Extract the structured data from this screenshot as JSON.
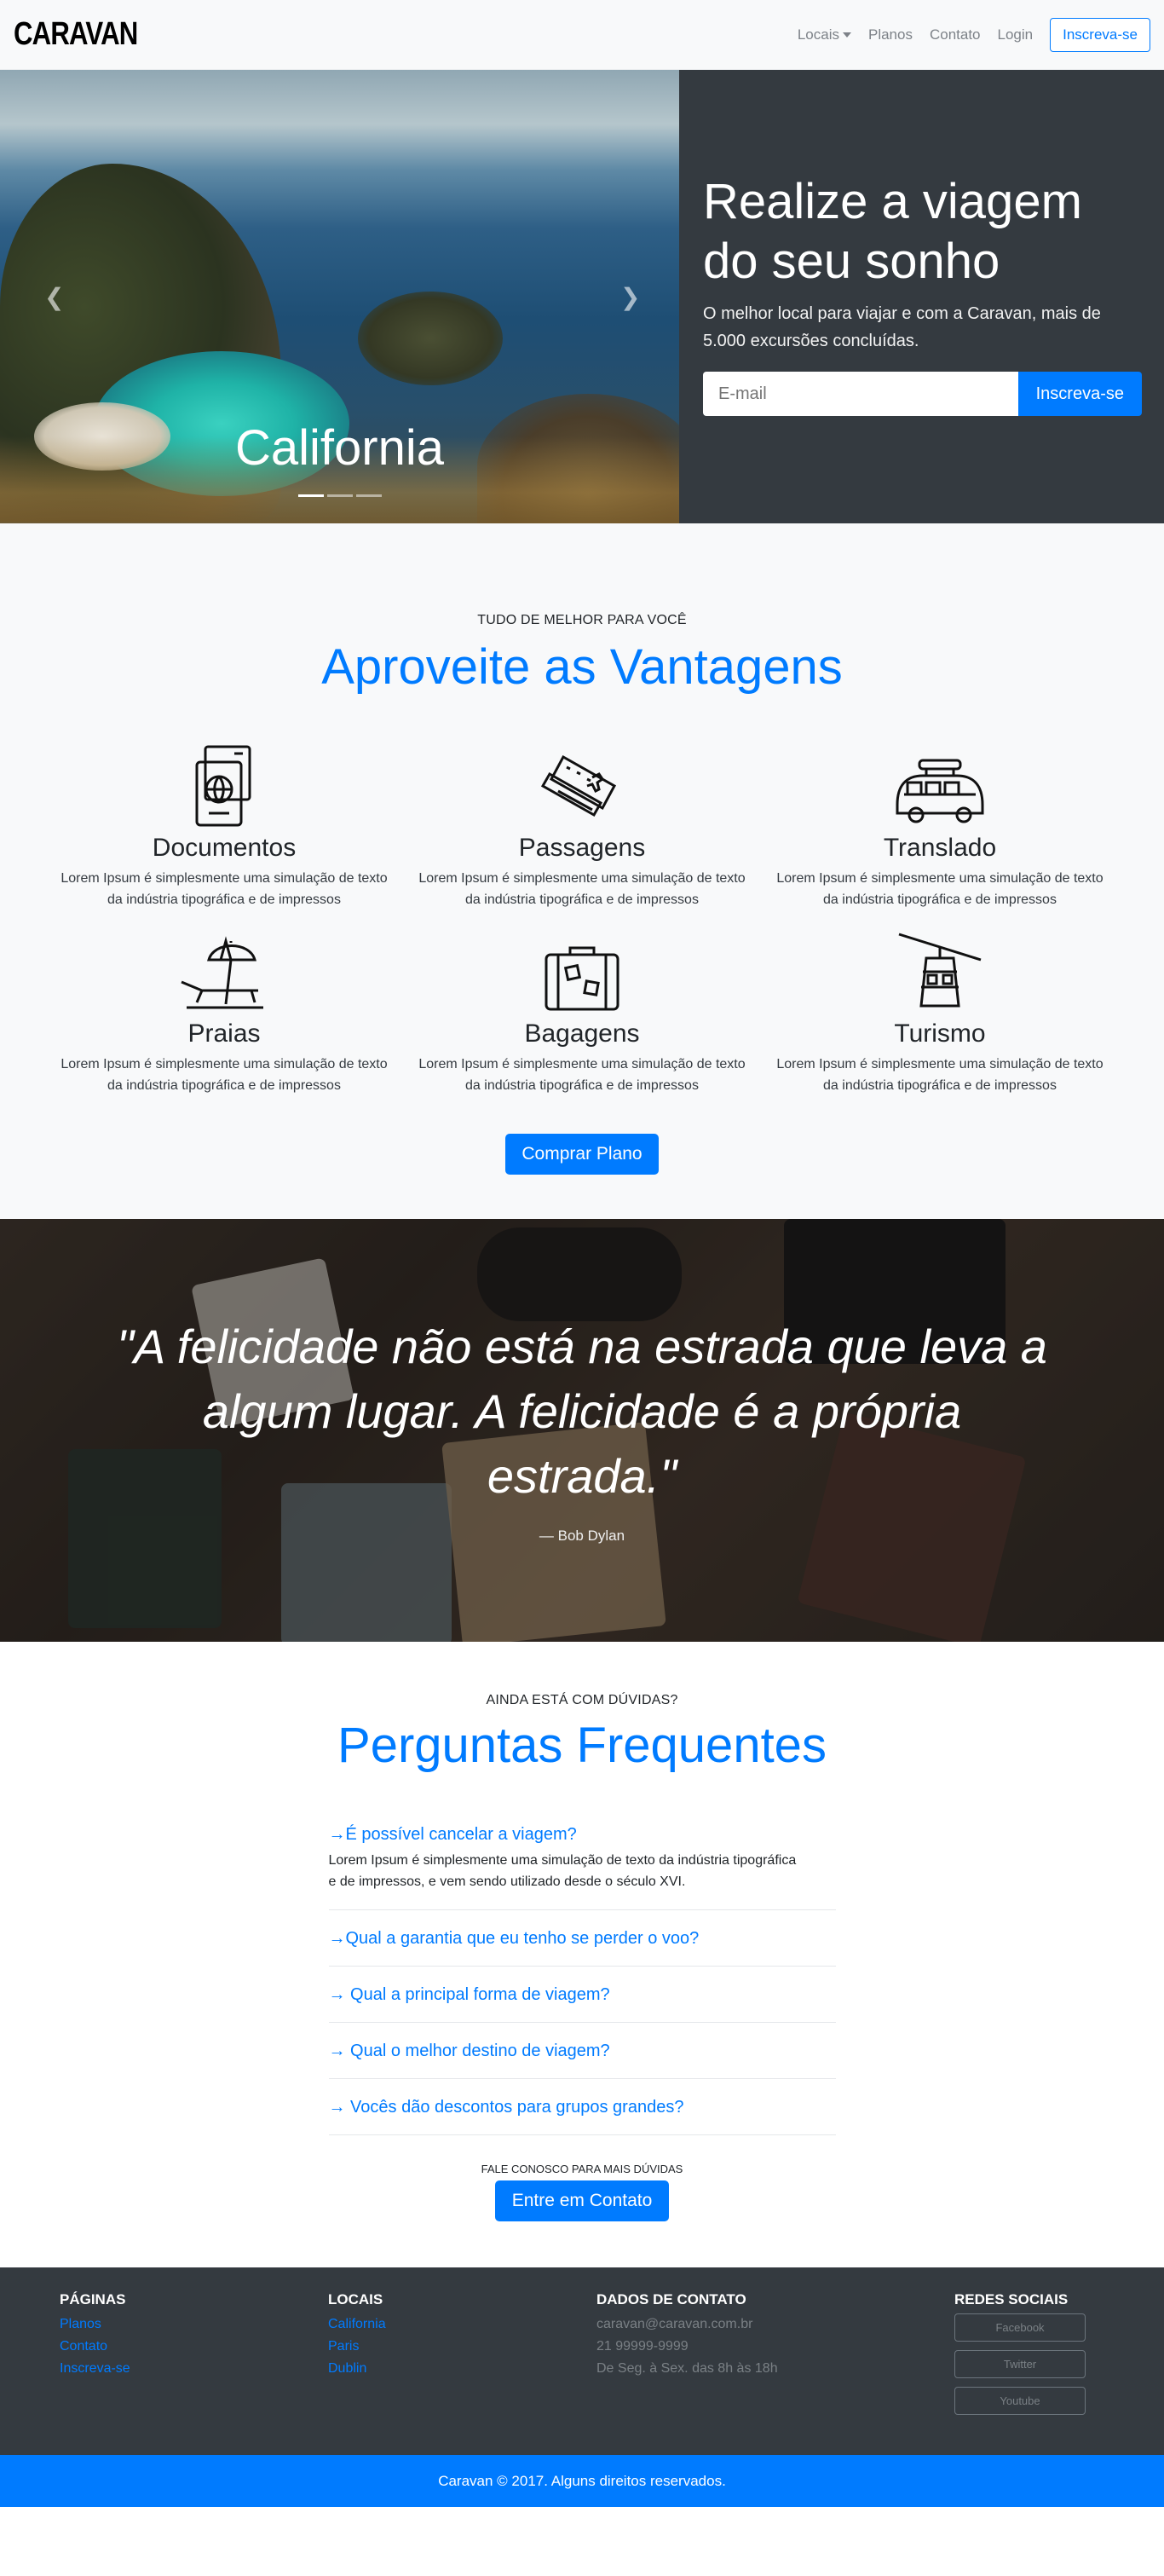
{
  "nav": {
    "brand": "CARAVAN",
    "links": {
      "locais": "Locais",
      "planos": "Planos",
      "contato": "Contato",
      "login": "Login"
    },
    "signup_label": "Inscreva-se"
  },
  "hero": {
    "carousel_caption": "California",
    "slides_count": 3,
    "active_slide": 1,
    "title": "Realize a viagem do seu sonho",
    "subtitle": "O melhor local para viajar e com a Caravan, mais de 5.000 excursões concluídas.",
    "email_placeholder": "E-mail",
    "signup_button": "Inscreva-se"
  },
  "features": {
    "eyebrow": "Tudo de melhor para você",
    "title": "Aproveite as Vantagens",
    "items": [
      {
        "title": "Documentos",
        "text": "Lorem Ipsum é simplesmente uma simulação de texto da indústria tipográfica e de impressos",
        "icon": "passport-icon"
      },
      {
        "title": "Passagens",
        "text": "Lorem Ipsum é simplesmente uma simulação de texto da indústria tipográfica e de impressos",
        "icon": "ticket-icon"
      },
      {
        "title": "Translado",
        "text": "Lorem Ipsum é simplesmente uma simulação de texto da indústria tipográfica e de impressos",
        "icon": "van-icon"
      },
      {
        "title": "Praias",
        "text": "Lorem Ipsum é simplesmente uma simulação de texto da indústria tipográfica e de impressos",
        "icon": "beach-chair-icon"
      },
      {
        "title": "Bagagens",
        "text": "Lorem Ipsum é simplesmente uma simulação de texto da indústria tipográfica e de impressos",
        "icon": "suitcase-icon"
      },
      {
        "title": "Turismo",
        "text": "Lorem Ipsum é simplesmente uma simulação de texto da indústria tipográfica e de impressos",
        "icon": "cable-car-icon"
      }
    ],
    "button": "Comprar Plano"
  },
  "quote": {
    "text": "\"A felicidade não está na estrada que leva a algum lugar. A felicidade é a própria estrada.\"",
    "author": "— Bob Dylan"
  },
  "faq": {
    "eyebrow": "Ainda está com dúvidas?",
    "title": "Perguntas Frequentes",
    "items": [
      {
        "question": "→É possível cancelar a viagem?",
        "answer": "Lorem Ipsum é simplesmente uma simulação de texto da indústria tipográfica e de impressos, e vem sendo utilizado desde o século XVI."
      },
      {
        "question": "→Qual a garantia que eu tenho se perder o voo?"
      },
      {
        "question": "→ Qual a principal forma de viagem?"
      },
      {
        "question": "→ Qual o melhor destino de viagem?"
      },
      {
        "question": "→ Vocês dão descontos para grupos grandes?"
      }
    ],
    "contact_label": "Fale conosco para mais dúvidas",
    "contact_button": "Entre em Contato"
  },
  "footer": {
    "pages": {
      "title": "Páginas",
      "links": [
        "Planos",
        "Contato",
        "Inscreva-se"
      ]
    },
    "locais": {
      "title": "Locais",
      "links": [
        "California",
        "Paris",
        "Dublin"
      ]
    },
    "contact": {
      "title": "Dados de Contato",
      "email": "caravan@caravan.com.br",
      "phone": "21 99999-9999",
      "hours": "De Seg. à Sex. das 8h às 18h"
    },
    "social": {
      "title": "Redes Sociais",
      "links": [
        "Facebook",
        "Twitter",
        "Youtube"
      ]
    },
    "copyright": "Caravan © 2017. Alguns direitos reservados."
  },
  "colors": {
    "primary": "#007bff",
    "dark": "#343a40",
    "light": "#f8f9fa"
  }
}
